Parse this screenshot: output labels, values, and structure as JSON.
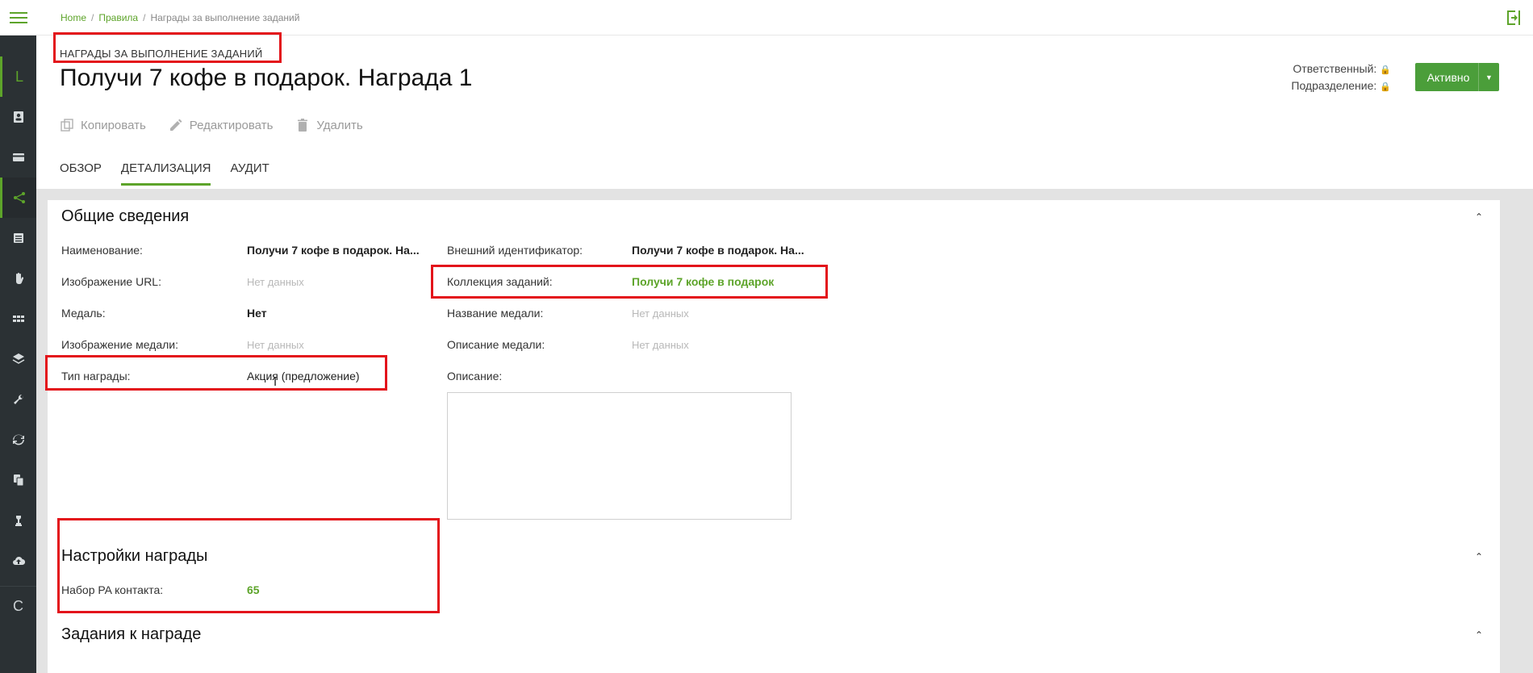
{
  "breadcrumb": {
    "home": "Home",
    "rules": "Правила",
    "current": "Награды за выполнение заданий"
  },
  "sidebar": {
    "top_letter": "L",
    "bottom_letter": "C",
    "icons": [
      "contact-card-icon",
      "credit-card-icon",
      "share-nodes-icon",
      "list-icon",
      "hand-icon",
      "grid-icon",
      "layers-icon",
      "wrench-icon",
      "sync-icon",
      "copy-files-icon",
      "chess-piece-icon",
      "cloud-upload-icon"
    ]
  },
  "header": {
    "kind": "НАГРАДЫ ЗА ВЫПОЛНЕНИЕ ЗАДАНИЙ",
    "title": "Получи 7 кофе в подарок. Награда 1",
    "responsible_label": "Ответственный:",
    "department_label": "Подразделение:",
    "status": "Активно"
  },
  "toolbar": {
    "copy": "Копировать",
    "edit": "Редактировать",
    "delete": "Удалить"
  },
  "tabs": [
    "ОБЗОР",
    "ДЕТАЛИЗАЦИЯ",
    "АУДИТ"
  ],
  "general": {
    "title": "Общие сведения",
    "name_label": "Наименование:",
    "name_value": "Получи 7 кофе в подарок. На...",
    "image_url_label": "Изображение URL:",
    "image_url_value": "Нет данных",
    "medal_label": "Медаль:",
    "medal_value": "Нет",
    "medal_image_label": "Изображение медали:",
    "medal_image_value": "Нет данных",
    "reward_type_label": "Тип награды:",
    "reward_type_value": "Акция (предложение)",
    "external_id_label": "Внешний идентификатор:",
    "external_id_value": "Получи 7 кофе в подарок. На...",
    "collection_label": "Коллекция заданий:",
    "collection_value": "Получи 7 кофе в подарок",
    "medal_name_label": "Название медали:",
    "medal_name_value": "Нет данных",
    "medal_desc_label": "Описание медали:",
    "medal_desc_value": "Нет данных",
    "description_label": "Описание:"
  },
  "settings": {
    "title": "Настройки награды",
    "pa_label": "Набор PA контакта:",
    "pa_value": "65"
  },
  "tasks": {
    "title": "Задания к награде"
  },
  "colors": {
    "accent": "#5da42a",
    "sidebar": "#2b3134",
    "status_button": "#4b9e3a",
    "highlight": "#e3141b"
  }
}
